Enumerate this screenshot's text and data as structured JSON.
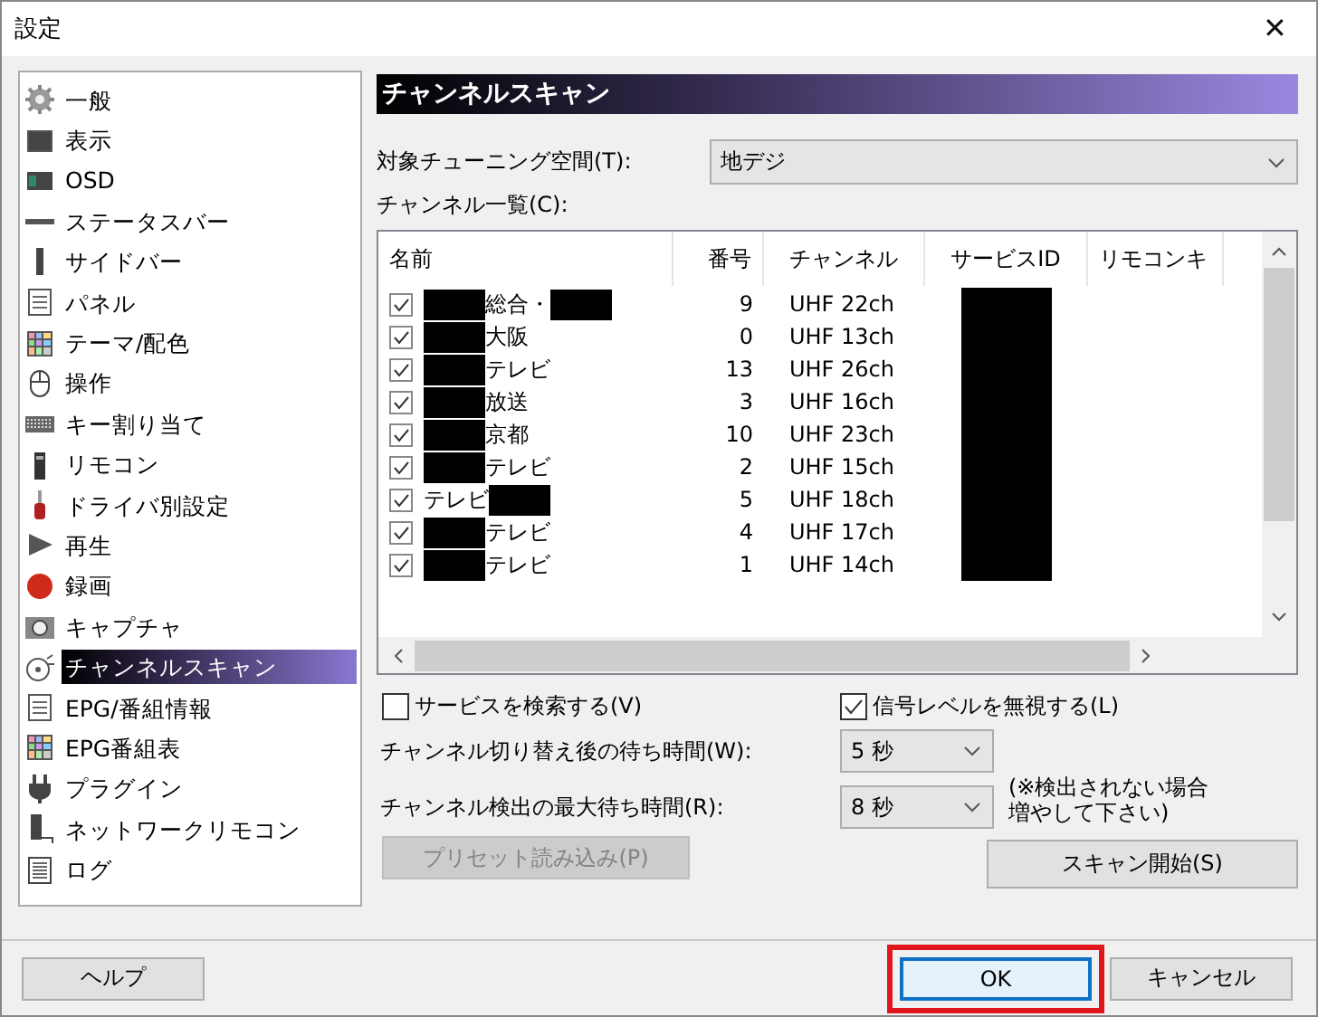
{
  "window": {
    "title": "設定",
    "close": "✕"
  },
  "sidebar": {
    "items": [
      {
        "label": "一般",
        "kind": "gear",
        "selected": false
      },
      {
        "label": "表示",
        "kind": "monitor",
        "selected": false
      },
      {
        "label": "OSD",
        "kind": "osd",
        "selected": false
      },
      {
        "label": "ステータスバー",
        "kind": "statusbar",
        "selected": false
      },
      {
        "label": "サイドバー",
        "kind": "sidebar",
        "selected": false
      },
      {
        "label": "パネル",
        "kind": "panel",
        "selected": false
      },
      {
        "label": "テーマ/配色",
        "kind": "palette",
        "selected": false
      },
      {
        "label": "操作",
        "kind": "mouse",
        "selected": false
      },
      {
        "label": "キー割り当て",
        "kind": "keyboard",
        "selected": false
      },
      {
        "label": "リモコン",
        "kind": "remote",
        "selected": false
      },
      {
        "label": "ドライバ別設定",
        "kind": "driver",
        "selected": false
      },
      {
        "label": "再生",
        "kind": "play",
        "selected": false
      },
      {
        "label": "録画",
        "kind": "record",
        "selected": false
      },
      {
        "label": "キャプチャ",
        "kind": "camera",
        "selected": false
      },
      {
        "label": "チャンネルスキャン",
        "kind": "dish",
        "selected": true
      },
      {
        "label": "EPG/番組情報",
        "kind": "panel",
        "selected": false
      },
      {
        "label": "EPG番組表",
        "kind": "palette",
        "selected": false
      },
      {
        "label": "プラグイン",
        "kind": "plug",
        "selected": false
      },
      {
        "label": "ネットワークリモコン",
        "kind": "netremote",
        "selected": false
      },
      {
        "label": "ログ",
        "kind": "log",
        "selected": false
      }
    ]
  },
  "panel": {
    "heading": "チャンネルスキャン",
    "tuning_space": {
      "label": "対象チューニング空間(T):",
      "value": "地デジ"
    },
    "channel_list": {
      "label": "チャンネル一覧(C):",
      "columns": [
        "名前",
        "番号",
        "チャンネル",
        "サービスID",
        "リモコンキ"
      ],
      "rows": [
        {
          "checked": true,
          "name": [
            {
              "kind": "redacted"
            },
            {
              "kind": "text",
              "text": "総合・"
            },
            {
              "kind": "redacted"
            }
          ],
          "number": "9",
          "channel": "UHF 22ch",
          "service_id_redacted": true
        },
        {
          "checked": true,
          "name": [
            {
              "kind": "redacted"
            },
            {
              "kind": "text",
              "text": "大阪"
            }
          ],
          "number": "0",
          "channel": "UHF 13ch",
          "service_id_redacted": true
        },
        {
          "checked": true,
          "name": [
            {
              "kind": "redacted"
            },
            {
              "kind": "text",
              "text": "テレビ"
            }
          ],
          "number": "13",
          "channel": "UHF 26ch",
          "service_id_redacted": true
        },
        {
          "checked": true,
          "name": [
            {
              "kind": "redacted"
            },
            {
              "kind": "text",
              "text": "放送"
            }
          ],
          "number": "3",
          "channel": "UHF 16ch",
          "service_id_redacted": true
        },
        {
          "checked": true,
          "name": [
            {
              "kind": "redacted"
            },
            {
              "kind": "text",
              "text": "京都"
            }
          ],
          "number": "10",
          "channel": "UHF 23ch",
          "service_id_redacted": true
        },
        {
          "checked": true,
          "name": [
            {
              "kind": "redacted"
            },
            {
              "kind": "text",
              "text": "テレビ"
            }
          ],
          "number": "2",
          "channel": "UHF 15ch",
          "service_id_redacted": true
        },
        {
          "checked": true,
          "name": [
            {
              "kind": "text",
              "text": "テレビ"
            },
            {
              "kind": "redacted"
            }
          ],
          "number": "5",
          "channel": "UHF 18ch",
          "service_id_redacted": true
        },
        {
          "checked": true,
          "name": [
            {
              "kind": "redacted"
            },
            {
              "kind": "text",
              "text": "テレビ"
            }
          ],
          "number": "4",
          "channel": "UHF 17ch",
          "service_id_redacted": true
        },
        {
          "checked": true,
          "name": [
            {
              "kind": "redacted"
            },
            {
              "kind": "text",
              "text": "テレビ"
            }
          ],
          "number": "1",
          "channel": "UHF 14ch",
          "service_id_redacted": true
        }
      ]
    },
    "search_services": {
      "label": "サービスを検索する(V)",
      "checked": false
    },
    "ignore_signal": {
      "label": "信号レベルを無視する(L)",
      "checked": true
    },
    "switch_wait": {
      "label": "チャンネル切り替え後の待ち時間(W):",
      "value": "5 秒"
    },
    "detect_wait": {
      "label": "チャンネル検出の最大待ち時間(R):",
      "value": "8 秒"
    },
    "note": [
      "(※検出されない場合",
      "増やして下さい)"
    ],
    "preset_button": {
      "label": "プリセット読み込み(P)",
      "disabled": true
    },
    "scan_button": {
      "label": "スキャン開始(S)",
      "disabled": false
    }
  },
  "footer": {
    "help": "ヘルプ",
    "ok": {
      "label": "OK",
      "highlighted": true
    },
    "cancel": "キャンセル"
  }
}
